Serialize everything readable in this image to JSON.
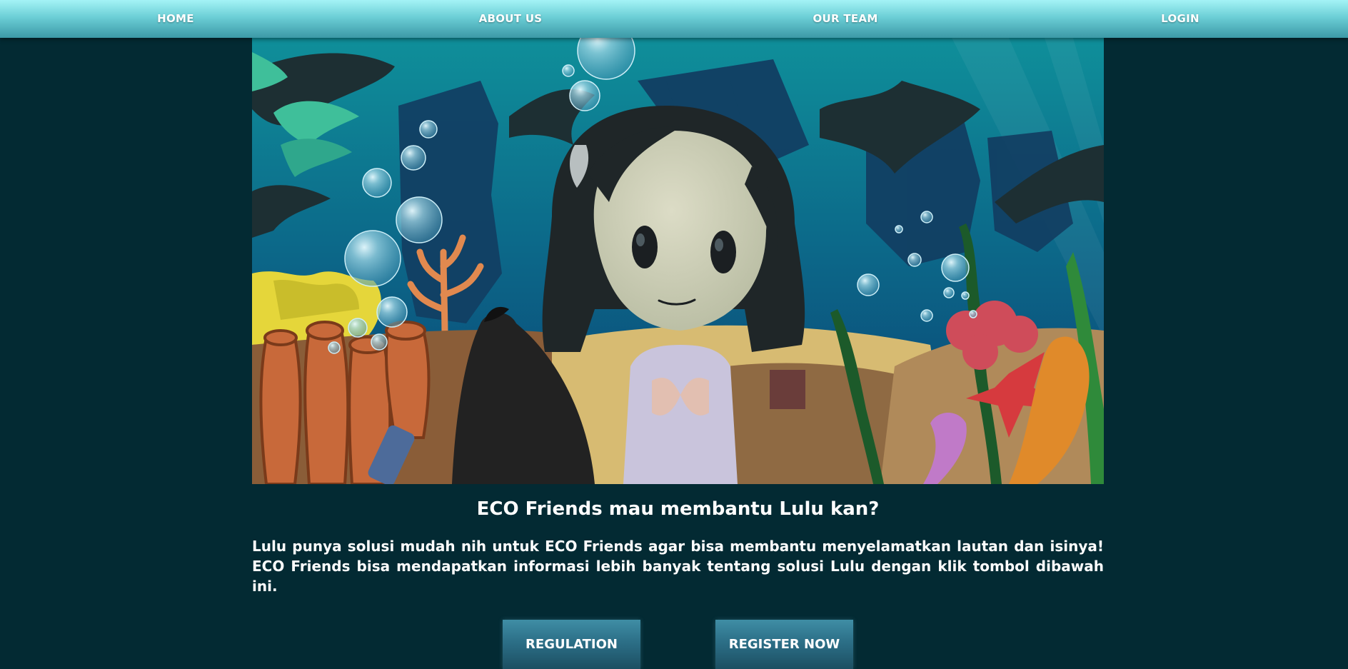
{
  "nav": {
    "items": [
      {
        "label": "HOME"
      },
      {
        "label": "ABOUT US"
      },
      {
        "label": "OUR TEAM"
      },
      {
        "label": "LOGIN"
      }
    ]
  },
  "hero": {
    "illustration": "underwater scene with Lulu character, corals, bubbles and a trash bag"
  },
  "content": {
    "headline": "ECO Friends mau membantu Lulu kan?",
    "body": "Lulu punya solusi mudah nih untuk ECO Friends agar bisa membantu menyelamatkan lautan dan isinya! ECO Friends bisa mendapatkan informasi lebih banyak tentang solusi Lulu dengan klik tombol dibawah ini."
  },
  "buttons": {
    "regulation": "REGULATION",
    "register": "REGISTER NOW"
  },
  "colors": {
    "background": "#032a33",
    "nav_top": "#a4f3f6",
    "nav_bottom": "#3c99a7",
    "button": "#2c6f87"
  }
}
